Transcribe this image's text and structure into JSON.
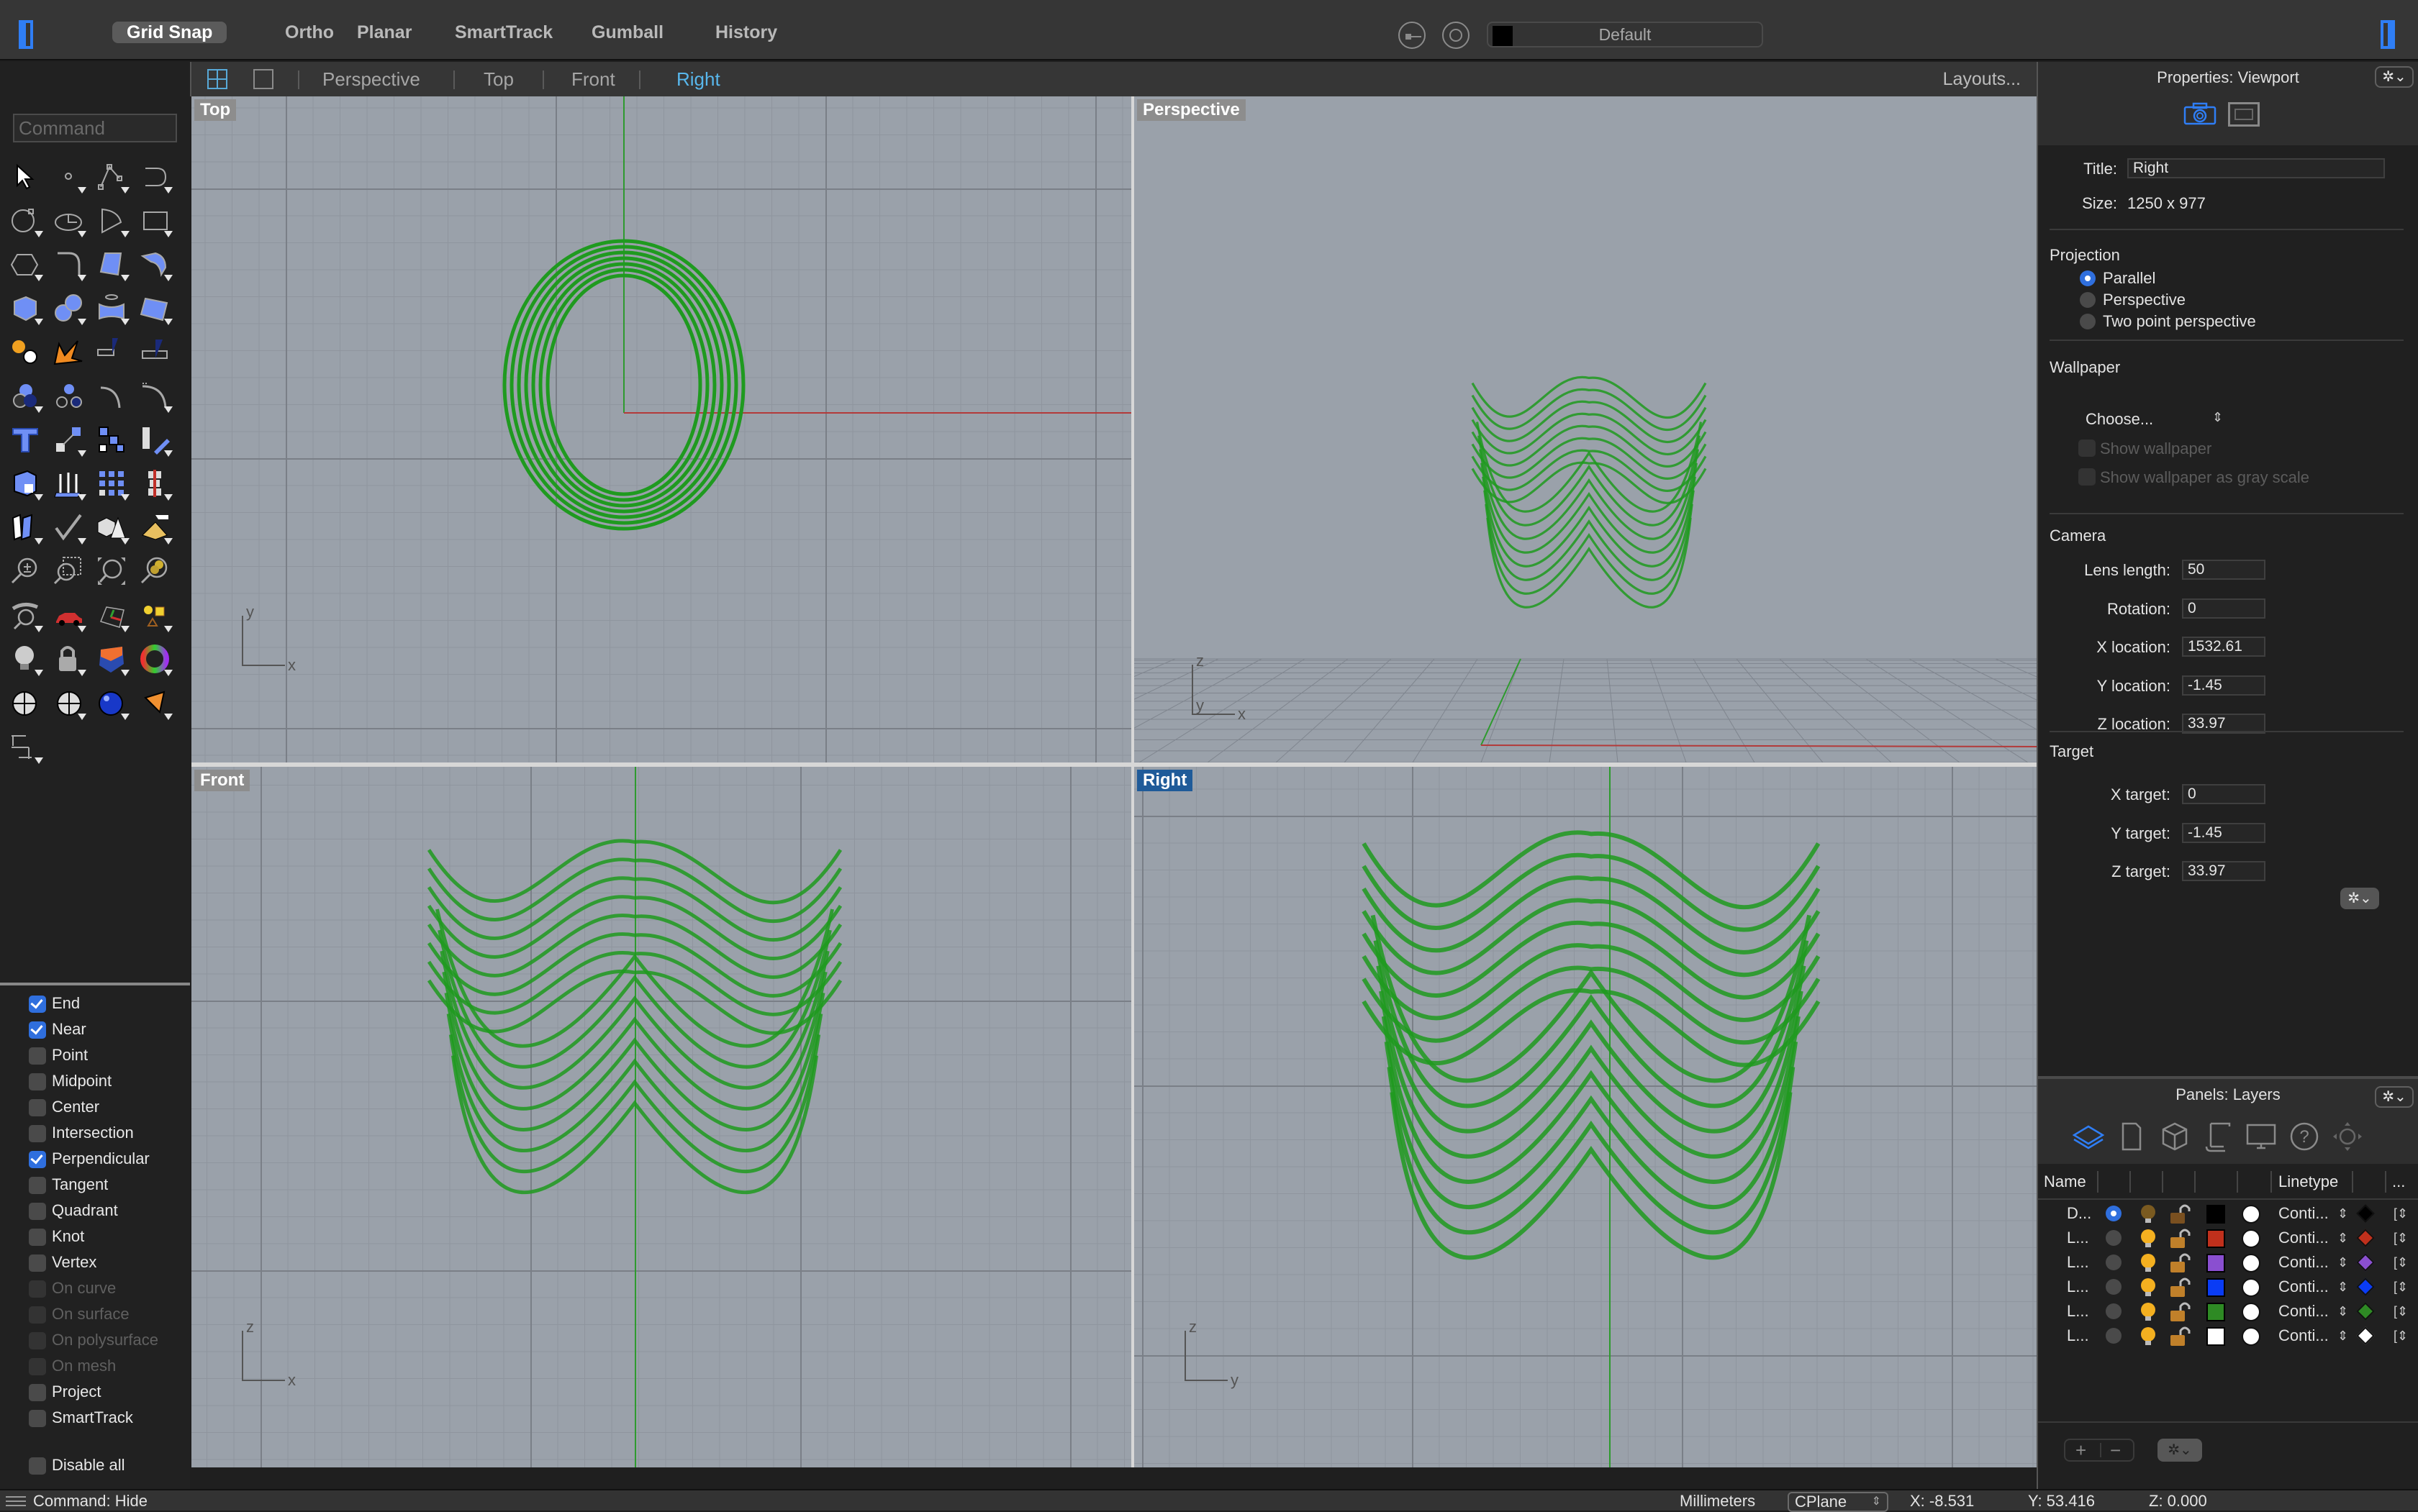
{
  "toolbar": {
    "modes": [
      {
        "label": "Grid Snap",
        "active": true
      },
      {
        "label": "Ortho",
        "active": false
      },
      {
        "label": "Planar",
        "active": false
      },
      {
        "label": "SmartTrack",
        "active": false
      },
      {
        "label": "Gumball",
        "active": false
      },
      {
        "label": "History",
        "active": false
      }
    ],
    "current_layer": "Default",
    "current_layer_color": "#000000"
  },
  "viewport_tabs": {
    "tabs": [
      {
        "label": "Perspective",
        "active": false
      },
      {
        "label": "Top",
        "active": false
      },
      {
        "label": "Front",
        "active": false
      },
      {
        "label": "Right",
        "active": true
      }
    ],
    "layouts_link": "Layouts..."
  },
  "command": {
    "placeholder": "Command",
    "last_command": "Command: Hide"
  },
  "tools": [
    "select-arrow-icon",
    "point-icon",
    "polyline-icon",
    "curve-icon",
    "circle-icon",
    "ellipse-icon",
    "arc-icon",
    "rectangle-icon",
    "polygon-icon",
    "fillet-curve-icon",
    "surface-from-points-icon",
    "extrude-surface-icon",
    "box-icon",
    "sphere-icon",
    "pipe-surface-icon",
    "network-surface-icon",
    "join-icon",
    "explode-icon",
    "trim-icon",
    "split-icon",
    "boolean-union-icon",
    "group-icon",
    "offset-curve-icon",
    "offset-surface-icon",
    "text-icon",
    "move-icon",
    "array-icon",
    "rotate-icon",
    "solid-edit-icon",
    "extrude-arrows-icon",
    "grid-array-icon",
    "mirror-icon",
    "boolean-split-icon",
    "check-icon",
    "solids-icon",
    "place-object-icon",
    "zoom-icon",
    "zoom-window-icon",
    "zoom-extents-icon",
    "zoom-selected-icon",
    "rotate-view-icon",
    "walkabout-car-icon",
    "cplane-icon",
    "select-objects-icon",
    "light-icon",
    "lock-icon",
    "layer-section-icon",
    "color-wheel-icon",
    "render-sphere-icon",
    "render-grid-sphere-icon",
    "material-sphere-icon",
    "spotlight-icon",
    "dimension-icon"
  ],
  "osnaps": [
    {
      "label": "End",
      "checked": true,
      "enabled": true
    },
    {
      "label": "Near",
      "checked": true,
      "enabled": true
    },
    {
      "label": "Point",
      "checked": false,
      "enabled": true
    },
    {
      "label": "Midpoint",
      "checked": false,
      "enabled": true
    },
    {
      "label": "Center",
      "checked": false,
      "enabled": true
    },
    {
      "label": "Intersection",
      "checked": false,
      "enabled": true
    },
    {
      "label": "Perpendicular",
      "checked": true,
      "enabled": true
    },
    {
      "label": "Tangent",
      "checked": false,
      "enabled": true
    },
    {
      "label": "Quadrant",
      "checked": false,
      "enabled": true
    },
    {
      "label": "Knot",
      "checked": false,
      "enabled": true
    },
    {
      "label": "Vertex",
      "checked": false,
      "enabled": true
    },
    {
      "label": "On curve",
      "checked": false,
      "enabled": false
    },
    {
      "label": "On surface",
      "checked": false,
      "enabled": false
    },
    {
      "label": "On polysurface",
      "checked": false,
      "enabled": false
    },
    {
      "label": "On mesh",
      "checked": false,
      "enabled": false
    },
    {
      "label": "Project",
      "checked": false,
      "enabled": true
    },
    {
      "label": "SmartTrack",
      "checked": false,
      "enabled": true
    },
    {
      "label": "Disable all",
      "checked": false,
      "enabled": true
    }
  ],
  "viewports": {
    "top": {
      "label": "Top",
      "axes": [
        "y",
        "x"
      ]
    },
    "perspective": {
      "label": "Perspective",
      "axes": [
        "z",
        "y",
        "x"
      ]
    },
    "front": {
      "label": "Front",
      "axes": [
        "z",
        "x"
      ]
    },
    "right": {
      "label": "Right",
      "axes": [
        "z",
        "y"
      ],
      "active": true
    },
    "geometry_color": "#1f9a1f"
  },
  "properties": {
    "title": "Properties: Viewport",
    "title_label": "Title:",
    "title_value": "Right",
    "size_label": "Size:",
    "size_value": "1250 x 977",
    "projection": {
      "heading": "Projection",
      "options": [
        {
          "label": "Parallel",
          "selected": true
        },
        {
          "label": "Perspective",
          "selected": false
        },
        {
          "label": "Two point perspective",
          "selected": false
        }
      ]
    },
    "wallpaper": {
      "heading": "Wallpaper",
      "choose": "Choose...",
      "show_wallpaper": "Show wallpaper",
      "show_gray": "Show wallpaper as gray scale"
    },
    "camera": {
      "heading": "Camera",
      "fields": [
        {
          "label": "Lens length:",
          "value": "50"
        },
        {
          "label": "Rotation:",
          "value": "0"
        },
        {
          "label": "X location:",
          "value": "1532.61"
        },
        {
          "label": "Y location:",
          "value": "-1.45"
        },
        {
          "label": "Z location:",
          "value": "33.97"
        }
      ]
    },
    "target": {
      "heading": "Target",
      "fields": [
        {
          "label": "X target:",
          "value": "0"
        },
        {
          "label": "Y target:",
          "value": "-1.45"
        },
        {
          "label": "Z target:",
          "value": "33.97"
        }
      ]
    }
  },
  "layers": {
    "title": "Panels: Layers",
    "columns": {
      "name": "Name",
      "linetype": "Linetype",
      "more": "..."
    },
    "rows": [
      {
        "name": "D...",
        "current": true,
        "on": false,
        "color": "#000000",
        "linetype": "Conti...",
        "print_color": "#000000"
      },
      {
        "name": "L...",
        "current": false,
        "on": true,
        "color": "#c0301c",
        "linetype": "Conti...",
        "print_color": "#c0301c"
      },
      {
        "name": "L...",
        "current": false,
        "on": true,
        "color": "#8a4fd0",
        "linetype": "Conti...",
        "print_color": "#8a4fd0"
      },
      {
        "name": "L...",
        "current": false,
        "on": true,
        "color": "#0a3cf5",
        "linetype": "Conti...",
        "print_color": "#0a3cf5"
      },
      {
        "name": "L...",
        "current": false,
        "on": true,
        "color": "#2e8a24",
        "linetype": "Conti...",
        "print_color": "#2e8a24"
      },
      {
        "name": "L...",
        "current": false,
        "on": true,
        "color": "#ffffff",
        "linetype": "Conti...",
        "print_color": "#ffffff"
      }
    ]
  },
  "status": {
    "units": "Millimeters",
    "cplane": "CPlane",
    "x": "X: -8.531",
    "y": "Y: 53.416",
    "z": "Z: 0.000"
  }
}
